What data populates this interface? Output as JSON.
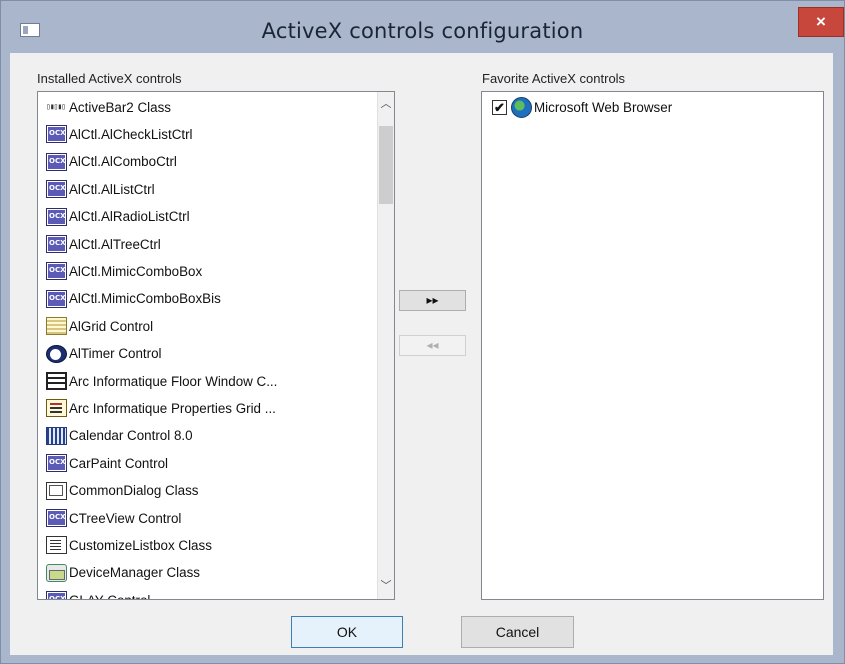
{
  "window": {
    "title": "ActiveX controls configuration",
    "close_glyph": "×"
  },
  "installed": {
    "label": "Installed ActiveX controls",
    "items": [
      {
        "icon": "bar-icon",
        "text": "ActiveBar2 Class"
      },
      {
        "icon": "ocx-icon",
        "text": "AlCtl.AlCheckListCtrl"
      },
      {
        "icon": "ocx-icon",
        "text": "AlCtl.AlComboCtrl"
      },
      {
        "icon": "ocx-icon",
        "text": "AlCtl.AlListCtrl"
      },
      {
        "icon": "ocx-icon",
        "text": "AlCtl.AlRadioListCtrl"
      },
      {
        "icon": "ocx-icon",
        "text": "AlCtl.AlTreeCtrl"
      },
      {
        "icon": "ocx-icon",
        "text": "AlCtl.MimicComboBox"
      },
      {
        "icon": "ocx-icon",
        "text": "AlCtl.MimicComboBoxBis"
      },
      {
        "icon": "grid-icon",
        "text": "AlGrid Control"
      },
      {
        "icon": "timer-icon",
        "text": "AlTimer Control"
      },
      {
        "icon": "window-icon",
        "text": "Arc Informatique Floor Window C..."
      },
      {
        "icon": "properties-icon",
        "text": "Arc Informatique Properties Grid ..."
      },
      {
        "icon": "calendar-icon",
        "text": "Calendar Control 8.0"
      },
      {
        "icon": "ocx-icon",
        "text": "CarPaint Control"
      },
      {
        "icon": "dialog-icon",
        "text": "CommonDialog Class"
      },
      {
        "icon": "ocx-icon",
        "text": "CTreeView Control"
      },
      {
        "icon": "listbox-icon",
        "text": "CustomizeListbox Class"
      },
      {
        "icon": "device-icon",
        "text": "DeviceManager Class"
      },
      {
        "icon": "ocx-icon",
        "text": "GLAY Control"
      }
    ]
  },
  "favorites": {
    "label": "Favorite ActiveX controls",
    "items": [
      {
        "icon": "globe-icon",
        "text": "Microsoft Web Browser",
        "checked": true
      }
    ]
  },
  "buttons": {
    "add_all": "▸▸",
    "remove_all": "◂◂",
    "ok": "OK",
    "cancel": "Cancel"
  },
  "icons": {
    "scroll_up": "︿",
    "scroll_down": "﹀",
    "check": "✔",
    "bar": "▯▮▯▮▯"
  },
  "colors": {
    "title_bar": "#a9b6cb",
    "close_button": "#c7473c",
    "dialog_bg": "#f0f0f0"
  }
}
